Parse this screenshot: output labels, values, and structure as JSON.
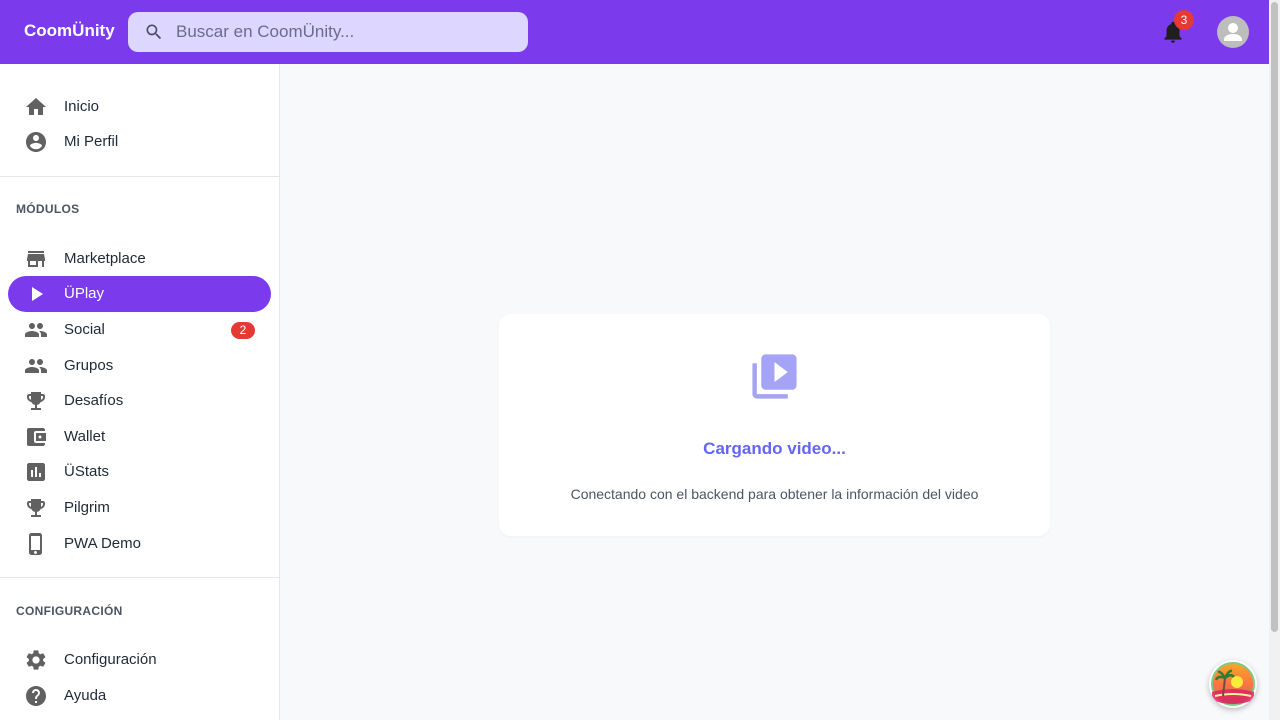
{
  "app": {
    "brand": "CoomÜnity"
  },
  "search": {
    "placeholder": "Buscar en CoomÜnity..."
  },
  "notifications": {
    "count": "3"
  },
  "sidebar": {
    "primary": [
      {
        "label": "Inicio",
        "icon": "home-icon"
      },
      {
        "label": "Mi Perfil",
        "icon": "account-circle-icon"
      }
    ],
    "modules_title": "MÓDULOS",
    "modules": [
      {
        "label": "Marketplace",
        "icon": "store-icon"
      },
      {
        "label": "ÜPlay",
        "icon": "play-icon",
        "active": true
      },
      {
        "label": "Social",
        "icon": "people-icon",
        "badge": "2"
      },
      {
        "label": "Grupos",
        "icon": "groups-icon"
      },
      {
        "label": "Desafíos",
        "icon": "trophy-icon"
      },
      {
        "label": "Wallet",
        "icon": "wallet-icon"
      },
      {
        "label": "ÜStats",
        "icon": "bar-chart-icon"
      },
      {
        "label": "Pilgrim",
        "icon": "trophy-icon"
      },
      {
        "label": "PWA Demo",
        "icon": "phone-icon"
      }
    ],
    "config_title": "CONFIGURACIÓN",
    "config": [
      {
        "label": "Configuración",
        "icon": "gear-icon"
      },
      {
        "label": "Ayuda",
        "icon": "help-icon"
      }
    ]
  },
  "main": {
    "loading_title": "Cargando video...",
    "loading_subtitle": "Conectando con el backend para obtener la información del video"
  },
  "colors": {
    "primary": "#7c3aed",
    "badge": "#e53935",
    "accent_text": "#6366f1"
  }
}
